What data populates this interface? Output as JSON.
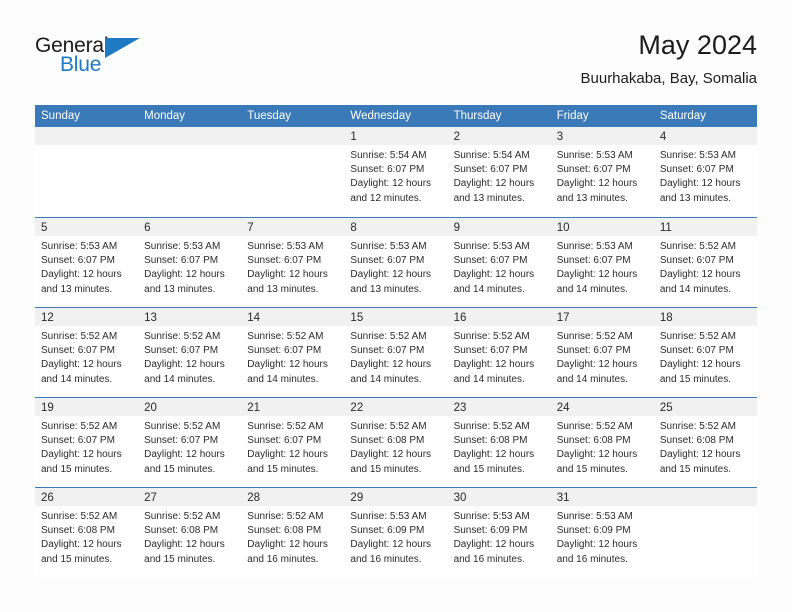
{
  "logo": {
    "general": "General",
    "blue": "Blue",
    "triangle_color": "#1f7ac4"
  },
  "header": {
    "title": "May 2024",
    "subtitle": "Buurhakaba, Bay, Somalia"
  },
  "theme": {
    "header_blue": "#3a7ab8",
    "day_band_gray": "#f1f1f1",
    "text": "#2b2b2b",
    "page_bg": "#fdfdfd"
  },
  "weekdays": [
    "Sunday",
    "Monday",
    "Tuesday",
    "Wednesday",
    "Thursday",
    "Friday",
    "Saturday"
  ],
  "weeks": [
    [
      {
        "day": "",
        "lines": []
      },
      {
        "day": "",
        "lines": []
      },
      {
        "day": "",
        "lines": []
      },
      {
        "day": "1",
        "lines": [
          "Sunrise: 5:54 AM",
          "Sunset: 6:07 PM",
          "Daylight: 12 hours",
          "and 12 minutes."
        ]
      },
      {
        "day": "2",
        "lines": [
          "Sunrise: 5:54 AM",
          "Sunset: 6:07 PM",
          "Daylight: 12 hours",
          "and 13 minutes."
        ]
      },
      {
        "day": "3",
        "lines": [
          "Sunrise: 5:53 AM",
          "Sunset: 6:07 PM",
          "Daylight: 12 hours",
          "and 13 minutes."
        ]
      },
      {
        "day": "4",
        "lines": [
          "Sunrise: 5:53 AM",
          "Sunset: 6:07 PM",
          "Daylight: 12 hours",
          "and 13 minutes."
        ]
      }
    ],
    [
      {
        "day": "5",
        "lines": [
          "Sunrise: 5:53 AM",
          "Sunset: 6:07 PM",
          "Daylight: 12 hours",
          "and 13 minutes."
        ]
      },
      {
        "day": "6",
        "lines": [
          "Sunrise: 5:53 AM",
          "Sunset: 6:07 PM",
          "Daylight: 12 hours",
          "and 13 minutes."
        ]
      },
      {
        "day": "7",
        "lines": [
          "Sunrise: 5:53 AM",
          "Sunset: 6:07 PM",
          "Daylight: 12 hours",
          "and 13 minutes."
        ]
      },
      {
        "day": "8",
        "lines": [
          "Sunrise: 5:53 AM",
          "Sunset: 6:07 PM",
          "Daylight: 12 hours",
          "and 13 minutes."
        ]
      },
      {
        "day": "9",
        "lines": [
          "Sunrise: 5:53 AM",
          "Sunset: 6:07 PM",
          "Daylight: 12 hours",
          "and 14 minutes."
        ]
      },
      {
        "day": "10",
        "lines": [
          "Sunrise: 5:53 AM",
          "Sunset: 6:07 PM",
          "Daylight: 12 hours",
          "and 14 minutes."
        ]
      },
      {
        "day": "11",
        "lines": [
          "Sunrise: 5:52 AM",
          "Sunset: 6:07 PM",
          "Daylight: 12 hours",
          "and 14 minutes."
        ]
      }
    ],
    [
      {
        "day": "12",
        "lines": [
          "Sunrise: 5:52 AM",
          "Sunset: 6:07 PM",
          "Daylight: 12 hours",
          "and 14 minutes."
        ]
      },
      {
        "day": "13",
        "lines": [
          "Sunrise: 5:52 AM",
          "Sunset: 6:07 PM",
          "Daylight: 12 hours",
          "and 14 minutes."
        ]
      },
      {
        "day": "14",
        "lines": [
          "Sunrise: 5:52 AM",
          "Sunset: 6:07 PM",
          "Daylight: 12 hours",
          "and 14 minutes."
        ]
      },
      {
        "day": "15",
        "lines": [
          "Sunrise: 5:52 AM",
          "Sunset: 6:07 PM",
          "Daylight: 12 hours",
          "and 14 minutes."
        ]
      },
      {
        "day": "16",
        "lines": [
          "Sunrise: 5:52 AM",
          "Sunset: 6:07 PM",
          "Daylight: 12 hours",
          "and 14 minutes."
        ]
      },
      {
        "day": "17",
        "lines": [
          "Sunrise: 5:52 AM",
          "Sunset: 6:07 PM",
          "Daylight: 12 hours",
          "and 14 minutes."
        ]
      },
      {
        "day": "18",
        "lines": [
          "Sunrise: 5:52 AM",
          "Sunset: 6:07 PM",
          "Daylight: 12 hours",
          "and 15 minutes."
        ]
      }
    ],
    [
      {
        "day": "19",
        "lines": [
          "Sunrise: 5:52 AM",
          "Sunset: 6:07 PM",
          "Daylight: 12 hours",
          "and 15 minutes."
        ]
      },
      {
        "day": "20",
        "lines": [
          "Sunrise: 5:52 AM",
          "Sunset: 6:07 PM",
          "Daylight: 12 hours",
          "and 15 minutes."
        ]
      },
      {
        "day": "21",
        "lines": [
          "Sunrise: 5:52 AM",
          "Sunset: 6:07 PM",
          "Daylight: 12 hours",
          "and 15 minutes."
        ]
      },
      {
        "day": "22",
        "lines": [
          "Sunrise: 5:52 AM",
          "Sunset: 6:08 PM",
          "Daylight: 12 hours",
          "and 15 minutes."
        ]
      },
      {
        "day": "23",
        "lines": [
          "Sunrise: 5:52 AM",
          "Sunset: 6:08 PM",
          "Daylight: 12 hours",
          "and 15 minutes."
        ]
      },
      {
        "day": "24",
        "lines": [
          "Sunrise: 5:52 AM",
          "Sunset: 6:08 PM",
          "Daylight: 12 hours",
          "and 15 minutes."
        ]
      },
      {
        "day": "25",
        "lines": [
          "Sunrise: 5:52 AM",
          "Sunset: 6:08 PM",
          "Daylight: 12 hours",
          "and 15 minutes."
        ]
      }
    ],
    [
      {
        "day": "26",
        "lines": [
          "Sunrise: 5:52 AM",
          "Sunset: 6:08 PM",
          "Daylight: 12 hours",
          "and 15 minutes."
        ]
      },
      {
        "day": "27",
        "lines": [
          "Sunrise: 5:52 AM",
          "Sunset: 6:08 PM",
          "Daylight: 12 hours",
          "and 15 minutes."
        ]
      },
      {
        "day": "28",
        "lines": [
          "Sunrise: 5:52 AM",
          "Sunset: 6:08 PM",
          "Daylight: 12 hours",
          "and 16 minutes."
        ]
      },
      {
        "day": "29",
        "lines": [
          "Sunrise: 5:53 AM",
          "Sunset: 6:09 PM",
          "Daylight: 12 hours",
          "and 16 minutes."
        ]
      },
      {
        "day": "30",
        "lines": [
          "Sunrise: 5:53 AM",
          "Sunset: 6:09 PM",
          "Daylight: 12 hours",
          "and 16 minutes."
        ]
      },
      {
        "day": "31",
        "lines": [
          "Sunrise: 5:53 AM",
          "Sunset: 6:09 PM",
          "Daylight: 12 hours",
          "and 16 minutes."
        ]
      },
      {
        "day": "",
        "lines": []
      }
    ]
  ]
}
